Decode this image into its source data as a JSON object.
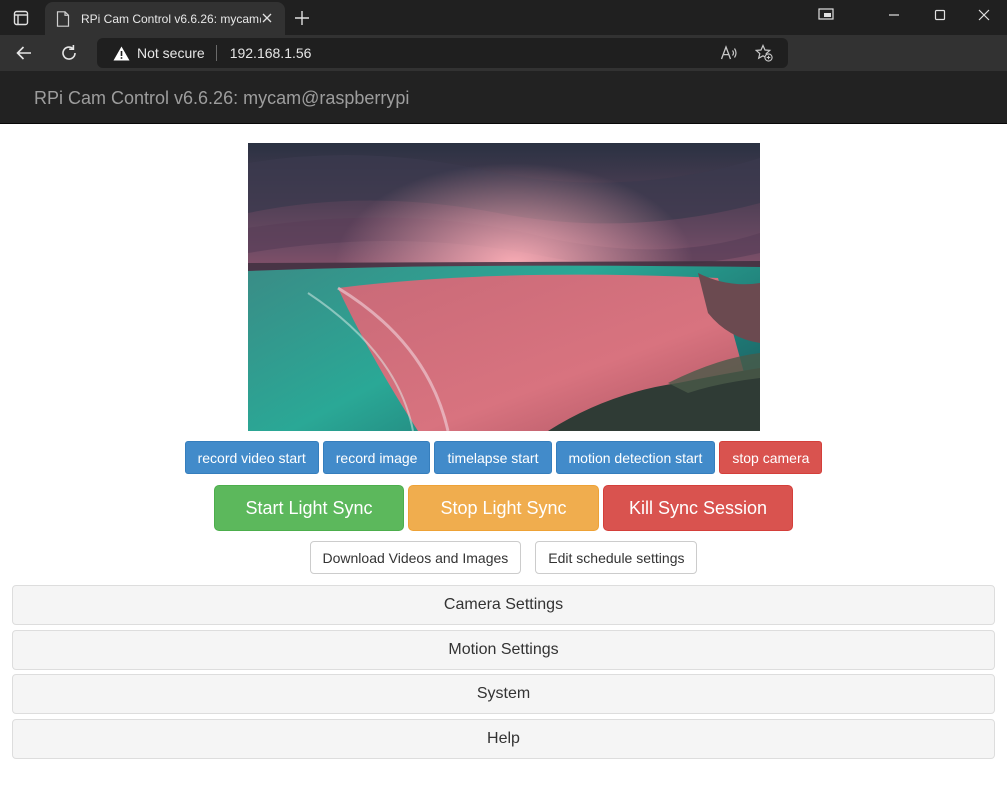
{
  "browser": {
    "tab_title": "RPi Cam Control v6.6.26: mycam@raspberrypi",
    "security_text": "Not secure",
    "url": "192.168.1.56"
  },
  "page": {
    "brand": "RPi Cam Control v6.6.26: mycam@raspberrypi"
  },
  "camera_buttons": [
    {
      "label": "record video start"
    },
    {
      "label": "record image"
    },
    {
      "label": "timelapse start"
    },
    {
      "label": "motion detection start"
    },
    {
      "label": "stop camera"
    }
  ],
  "sync_buttons": [
    {
      "label": "Start Light Sync"
    },
    {
      "label": "Stop Light Sync"
    },
    {
      "label": "Kill Sync Session"
    }
  ],
  "utility_buttons": [
    {
      "label": "Download Videos and Images"
    },
    {
      "label": "Edit schedule settings"
    }
  ],
  "panels": [
    {
      "label": "Camera Settings"
    },
    {
      "label": "Motion Settings"
    },
    {
      "label": "System"
    },
    {
      "label": "Help"
    }
  ],
  "colors": {
    "primary": "#428bca",
    "danger": "#d9534f",
    "success": "#5cb85c",
    "warning": "#f0ad4e",
    "navbar": "#222222"
  },
  "icons": [
    "tab-actions-icon",
    "favicon-icon",
    "close-icon",
    "plus-icon",
    "snap-layout-icon",
    "minimize-icon",
    "maximize-icon",
    "back-arrow-icon",
    "refresh-icon",
    "warning-triangle-icon",
    "read-aloud-icon",
    "favorite-add-icon"
  ]
}
